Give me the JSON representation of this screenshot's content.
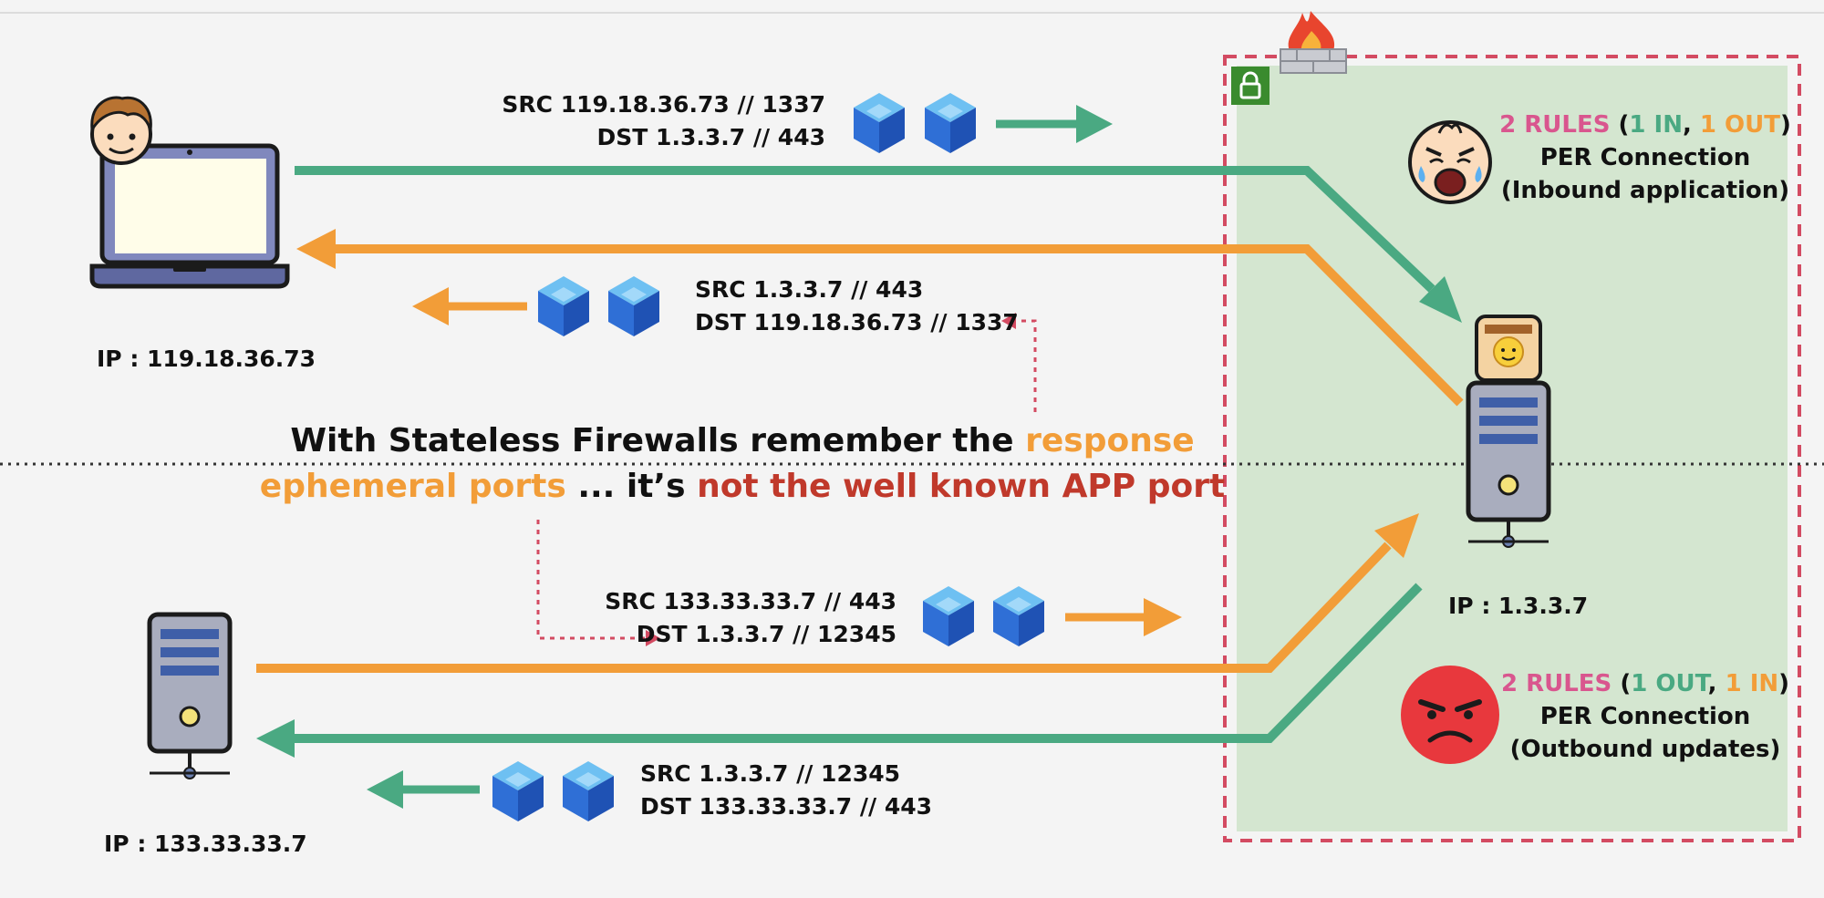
{
  "colors": {
    "green": "#4aa982",
    "orange": "#f29d38",
    "pink": "#d9568e",
    "red_text": "#c0392b",
    "zone_fill": "#d4e6d0",
    "zone_border": "#d34b62",
    "packet": "#2f6fd6"
  },
  "client": {
    "ip": "IP : 119.18.36.73",
    "outbound_packet": {
      "src": "SRC 119.18.36.73 // 1337",
      "dst": "DST 1.3.3.7 // 443"
    },
    "response_packet": {
      "src": "SRC 1.3.3.7 // 443",
      "dst": "DST 119.18.36.73 // 1337"
    }
  },
  "app_server": {
    "ip": "IP : 1.3.3.7"
  },
  "update_server": {
    "ip": "IP : 133.33.33.7",
    "response_packet": {
      "src": "SRC 133.33.33.7 // 443",
      "dst": "DST 1.3.3.7 // 12345"
    },
    "request_packet": {
      "src": "SRC 1.3.3.7 // 12345",
      "dst": "DST 133.33.33.7 // 443"
    }
  },
  "inbound_rules": {
    "count": "2 RULES",
    "open": " (",
    "in": "1 IN",
    "sep": ", ",
    "out": "1 OUT",
    "close": ")",
    "line2": "PER Connection",
    "line3": "(Inbound application)"
  },
  "outbound_rules": {
    "count": "2 RULES",
    "open": " (",
    "out": "1 OUT",
    "sep": ", ",
    "in": "1 IN",
    "close": ")",
    "line2": "PER Connection",
    "line3": "(Outbound updates)"
  },
  "headline": {
    "l1_a": "With Stateless Firewalls remember the ",
    "l1_b": "response",
    "l2_a": "ephemeral ports",
    "l2_b": " ... it’s ",
    "l2_c": "not the well known APP port"
  },
  "icons": {
    "user": "user-avatar-icon",
    "laptop": "laptop-icon",
    "firewall": "firewall-icon",
    "lock": "lock-icon",
    "server": "server-icon",
    "packet": "packet-cube-icon",
    "crying": "crying-face-icon",
    "angry": "angry-face-icon"
  }
}
